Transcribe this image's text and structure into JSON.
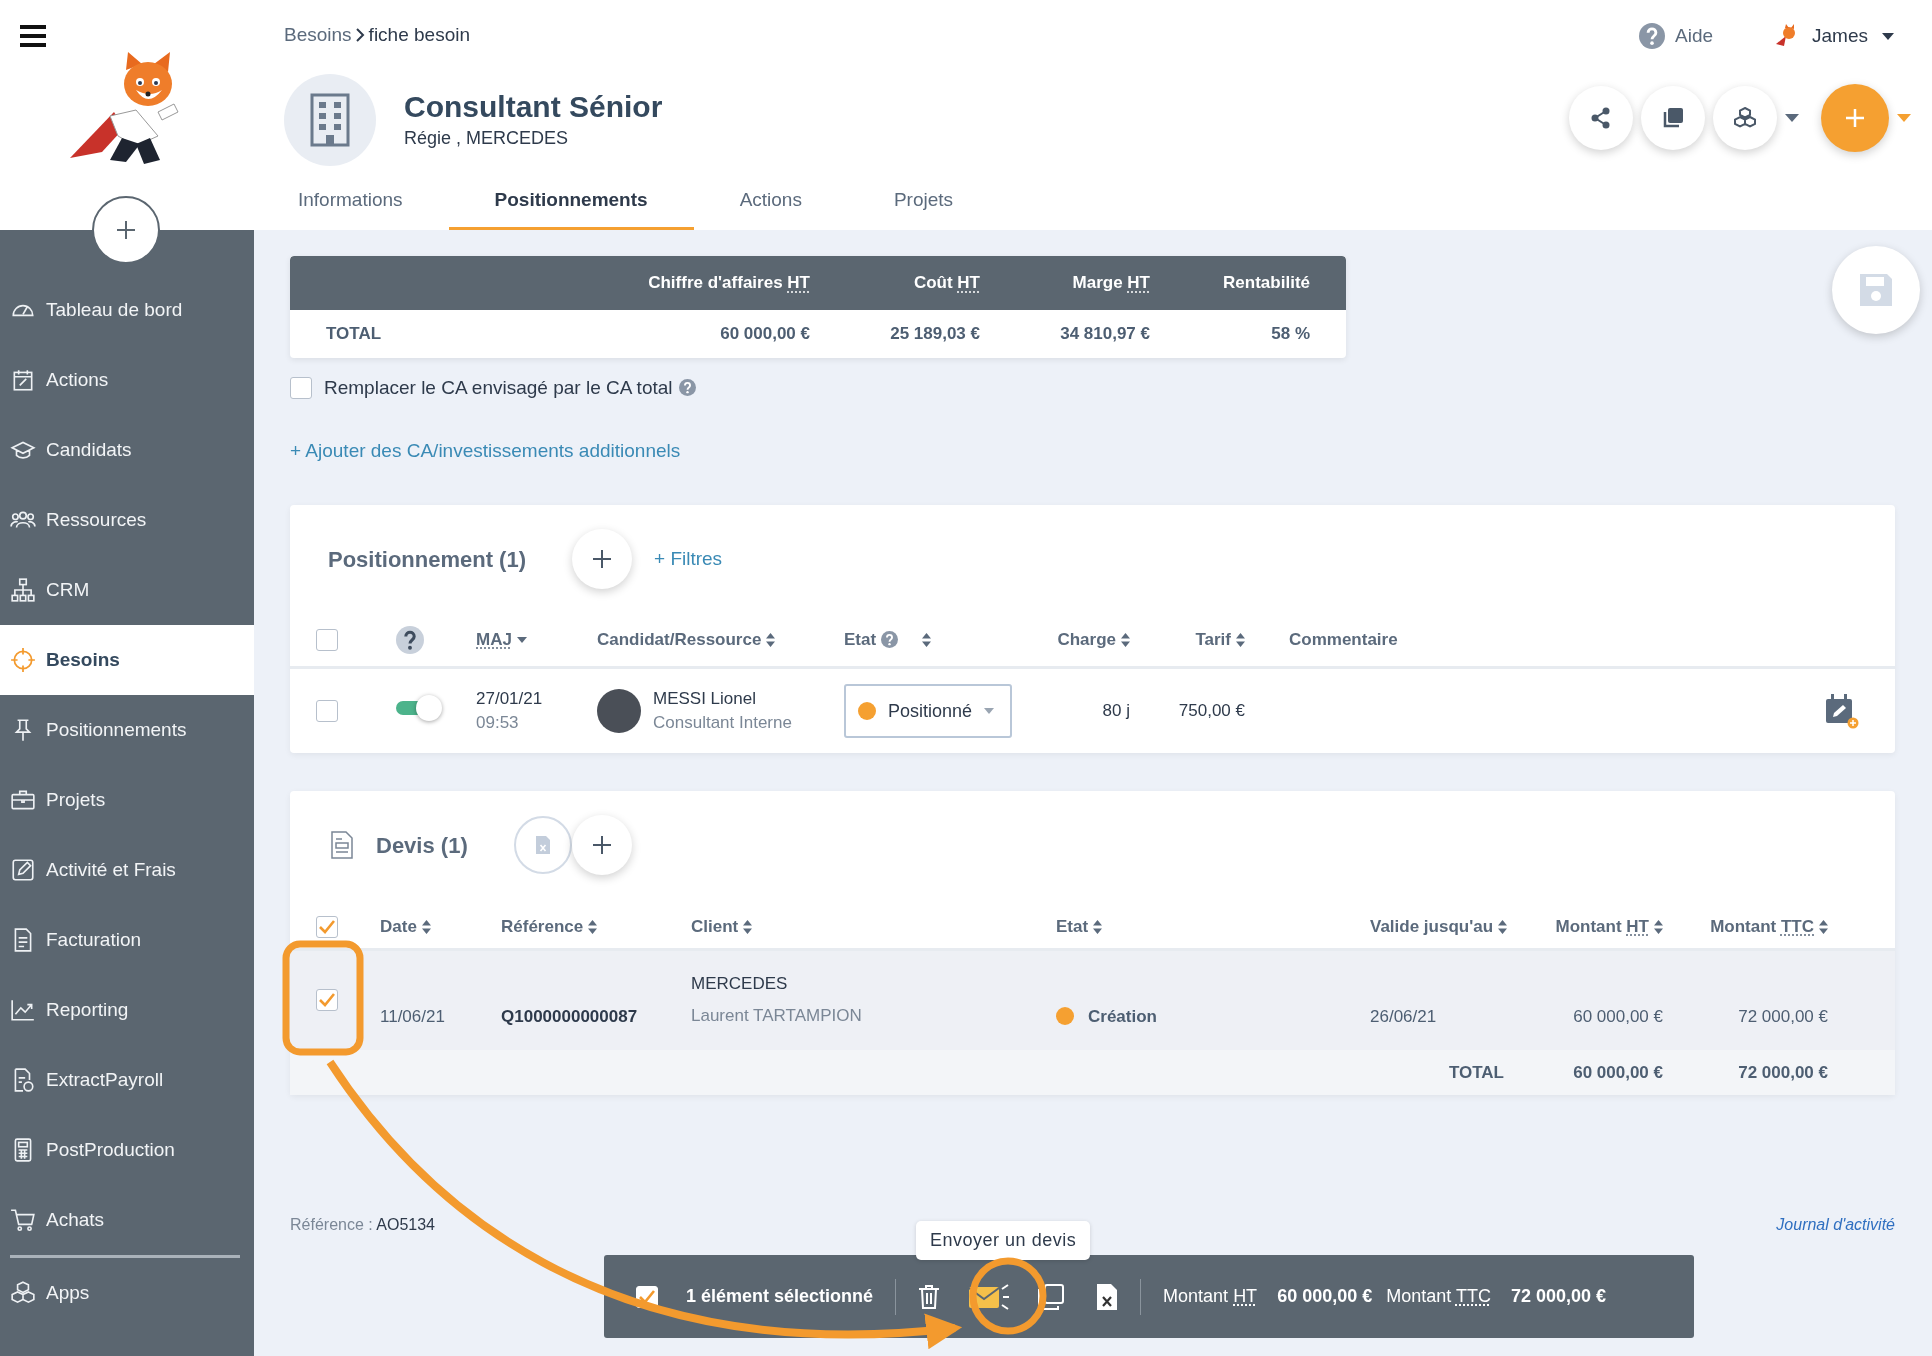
{
  "sidebar": {
    "items": [
      {
        "label": "Tableau de bord",
        "selected": false
      },
      {
        "label": "Actions",
        "selected": false
      },
      {
        "label": "Candidats",
        "selected": false
      },
      {
        "label": "Ressources",
        "selected": false
      },
      {
        "label": "CRM",
        "selected": false
      },
      {
        "label": "Besoins",
        "selected": true
      },
      {
        "label": "Positionnements",
        "selected": false
      },
      {
        "label": "Projets",
        "selected": false
      },
      {
        "label": "Activité et Frais",
        "selected": false
      },
      {
        "label": "Facturation",
        "selected": false
      },
      {
        "label": "Reporting",
        "selected": false
      },
      {
        "label": "ExtractPayroll",
        "selected": false
      },
      {
        "label": "PostProduction",
        "selected": false
      },
      {
        "label": "Achats",
        "selected": false
      },
      {
        "label": "Apps",
        "selected": false
      }
    ]
  },
  "breadcrumb": {
    "parent": "Besoins",
    "current": "fiche besoin"
  },
  "header": {
    "title": "Consultant Sénior",
    "subtitle": "Régie , MERCEDES"
  },
  "help_link": "Aide",
  "user": "James",
  "tabs": [
    {
      "label": "Informations",
      "selected": false
    },
    {
      "label": "Positionnements",
      "selected": true
    },
    {
      "label": "Actions",
      "selected": false
    },
    {
      "label": "Projets",
      "selected": false
    }
  ],
  "totals": {
    "columns": [
      {
        "label": "Chiffre d'affaires",
        "abbr": "HT"
      },
      {
        "label": "Coût",
        "abbr": "HT"
      },
      {
        "label": "Marge",
        "abbr": "HT"
      },
      {
        "label": "Rentabilité"
      }
    ],
    "row_label": "TOTAL",
    "values": [
      "60 000,00 €",
      "25 189,03 €",
      "34 810,97 €",
      "58 %"
    ]
  },
  "replace_ca": {
    "label": "Remplacer le CA envisagé par le CA total",
    "checked": false
  },
  "add_link": "+ Ajouter des CA/investissements additionnels",
  "positionnement": {
    "title": "Positionnement (1)",
    "filters": "+ Filtres",
    "all_checked": false,
    "columns": [
      {
        "kind": "help"
      },
      {
        "kind": "text",
        "label": "MAJ",
        "sorted": true
      },
      {
        "kind": "text",
        "label": "Candidat/Ressource",
        "sorted": false
      },
      {
        "kind": "text",
        "label": "Etat",
        "help": true,
        "sorted": false
      },
      {
        "kind": "text",
        "label": "Charge",
        "sorted": false
      },
      {
        "kind": "text",
        "label": "Tarif",
        "sorted": false
      },
      {
        "kind": "plain",
        "label": "Commentaire"
      }
    ],
    "rows": [
      {
        "selected": false,
        "on": true,
        "date": "27/01/21",
        "time": "09:53",
        "name": "MESSI Lionel",
        "role": "Consultant Interne",
        "state": "Positionné",
        "color": "#f5a031",
        "charge": "80 j",
        "tarif": "750,00 €"
      }
    ]
  },
  "devis": {
    "title": "Devis (1)",
    "all_checked": true,
    "columns": [
      {
        "label": "Date",
        "sorted": false
      },
      {
        "label": "Référence",
        "sorted": false
      },
      {
        "label": "Client",
        "sorted": false
      },
      {
        "label": "Etat",
        "sorted": false
      },
      {
        "label": "Valide jusqu'au",
        "sorted": false
      },
      {
        "label": "Montant",
        "abbr": "HT",
        "sorted": false
      },
      {
        "label": "Montant",
        "abbr": "TTC",
        "sorted": false
      }
    ],
    "rows": [
      {
        "selected": true,
        "date": "11/06/21",
        "reference": "Q1000000000087",
        "client": "MERCEDES",
        "contact": "Laurent TARTAMPION",
        "state": "Création",
        "color": "#f5a031",
        "valid_until": "26/06/21",
        "amount_ht": "60 000,00 €",
        "amount_ttc": "72 000,00 €"
      }
    ],
    "total": {
      "label": "TOTAL",
      "ht": "60 000,00 €",
      "ttc": "72 000,00 €"
    }
  },
  "footer": {
    "reference_label": "Référence :",
    "reference": "AO5134",
    "journal": "Journal d'activité"
  },
  "bulk_bar": {
    "checked": true,
    "selection": "1 élément sélectionné",
    "tooltip": "Envoyer un devis",
    "ht_label": "Montant",
    "ht_abbr": "HT",
    "ht": "60 000,00 €",
    "ttc_label": "Montant",
    "ttc_abbr": "TTC",
    "ttc": "72 000,00 €"
  }
}
